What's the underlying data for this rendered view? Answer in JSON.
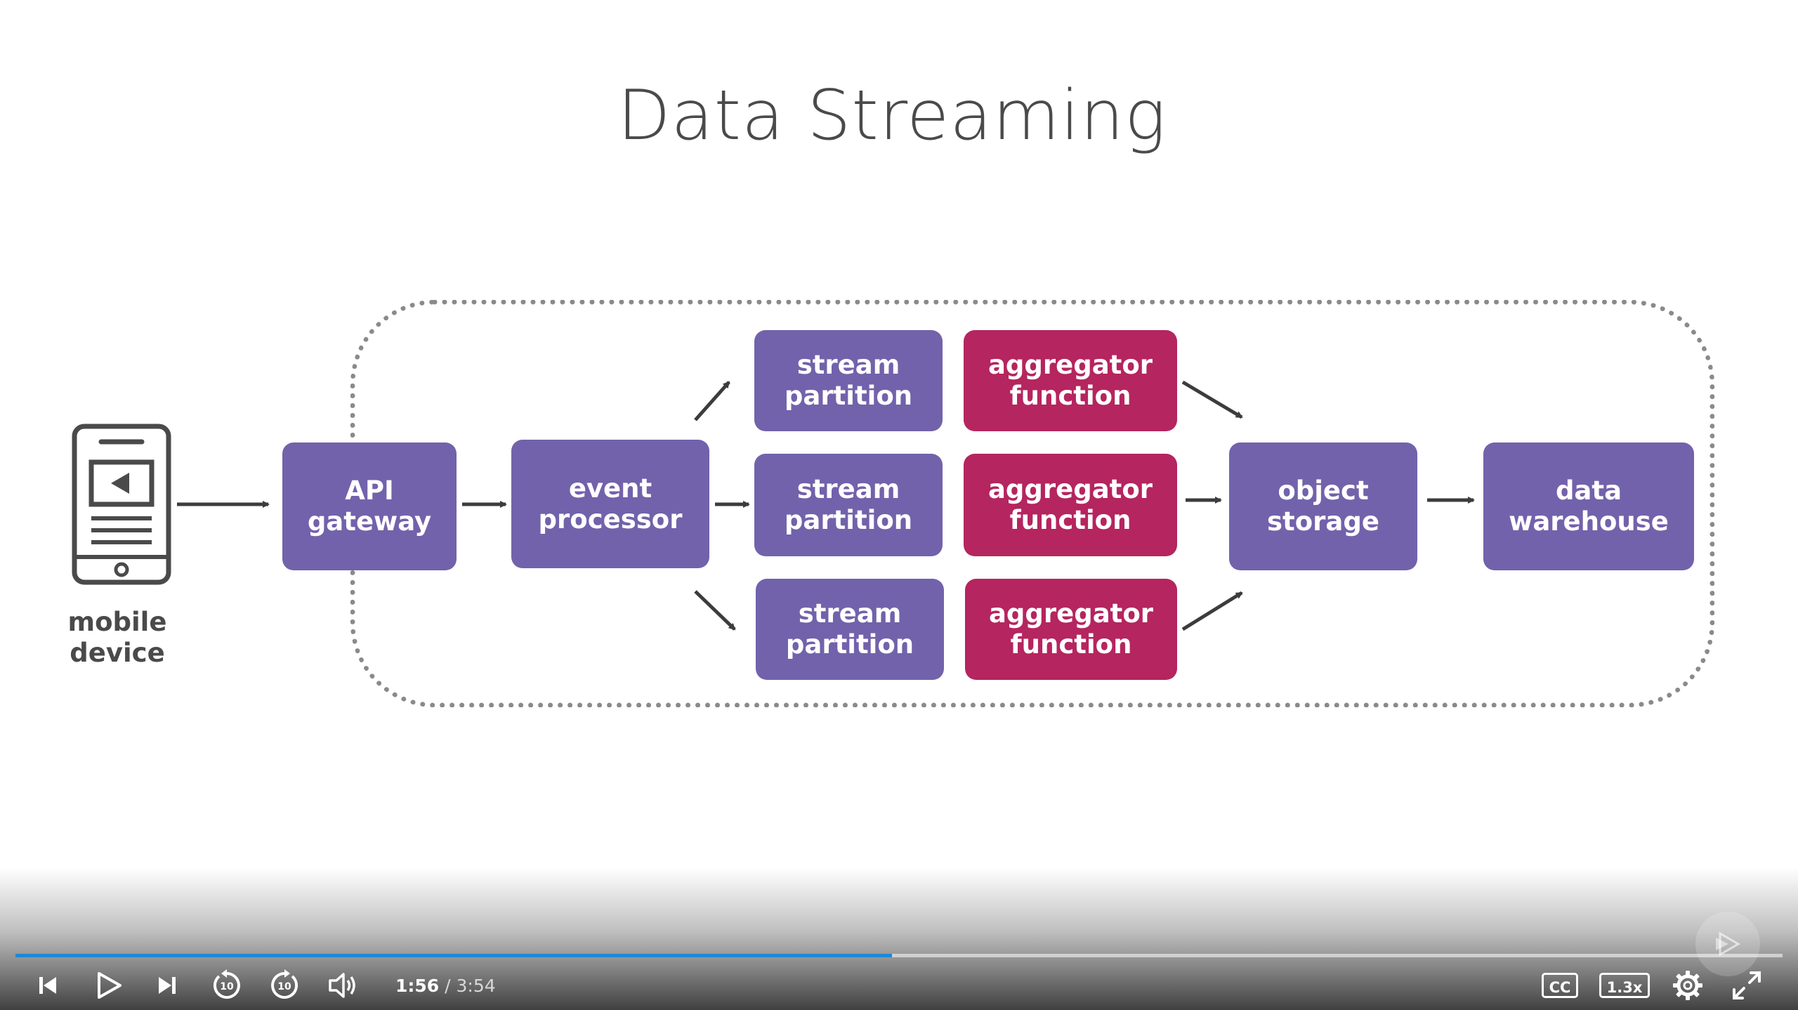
{
  "slide": {
    "title": "Data Streaming",
    "device_label": "mobile\ndevice",
    "api_gateway": "API\ngateway",
    "event_processor": "event\nprocessor",
    "partitions": [
      "stream\npartition",
      "stream\npartition",
      "stream\npartition"
    ],
    "aggregators": [
      "aggregator\nfunction",
      "aggregator\nfunction",
      "aggregator\nfunction"
    ],
    "object_storage": "object\nstorage",
    "data_warehouse": "data\nwarehouse",
    "colors": {
      "purple": "#7262ab",
      "magenta": "#b5255f",
      "boundary": "#8a8a8a"
    }
  },
  "player": {
    "current_time": "1:56",
    "separator": "/",
    "duration": "3:54",
    "progress_fraction": 0.496,
    "skip_back_seconds": "10",
    "skip_forward_seconds": "10",
    "captions_label": "CC",
    "speed_label": "1.3x",
    "icons": [
      "previous-icon",
      "play-icon",
      "next-icon",
      "rewind-10-icon",
      "forward-10-icon",
      "volume-icon",
      "captions-icon",
      "speed-icon",
      "settings-icon",
      "fullscreen-icon"
    ],
    "accent_color": "#1e88d6"
  }
}
